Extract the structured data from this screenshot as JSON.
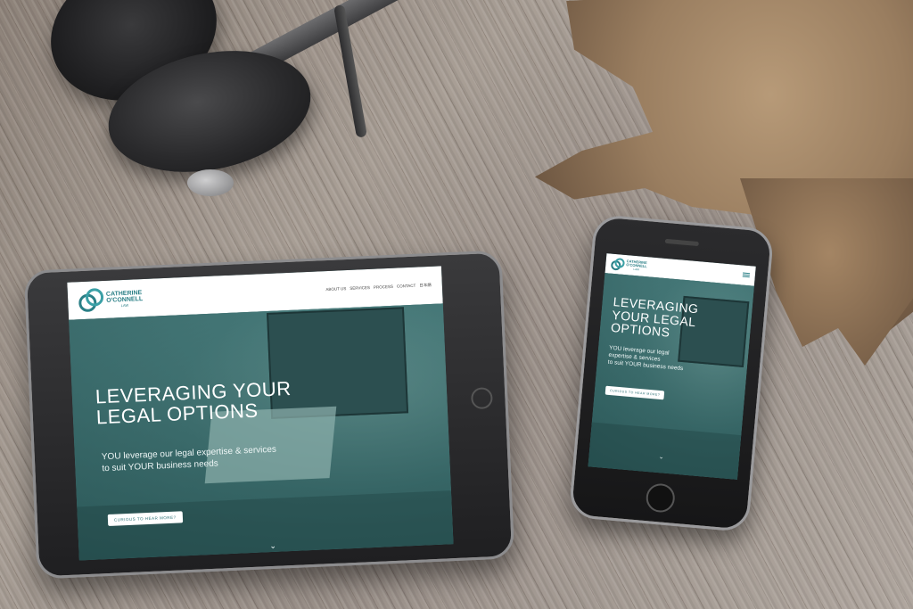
{
  "site": {
    "logo": {
      "line1": "CATHERINE",
      "line2": "O'CONNELL",
      "line3": "LAW"
    },
    "nav": [
      "ABOUT US",
      "SERVICES",
      "PROCESS",
      "CONTACT",
      "日本語"
    ],
    "hero": {
      "title_line1": "LEVERAGING YOUR",
      "title_line2": "LEGAL OPTIONS",
      "subtitle_line1": "YOU leverage our legal expertise & services",
      "subtitle_line2": "to suit YOUR business needs",
      "button": "CURIOUS TO HEAR MORE?"
    },
    "phone_hero": {
      "title_line1": "LEVERAGING",
      "title_line2": "YOUR LEGAL",
      "title_line3": "OPTIONS",
      "subtitle_line1": "YOU leverage our legal",
      "subtitle_line2": "expertise & services",
      "subtitle_line3": "to suit YOUR business needs",
      "button": "CURIOUS TO HEAR MORE?"
    }
  },
  "colors": {
    "brand_teal": "#2a7f86",
    "hero_overlay": "#3f6e6e",
    "header_bg": "#ffffff"
  },
  "icons": [
    "logo-mark-icon",
    "hamburger-menu-icon",
    "chevron-down-icon"
  ]
}
